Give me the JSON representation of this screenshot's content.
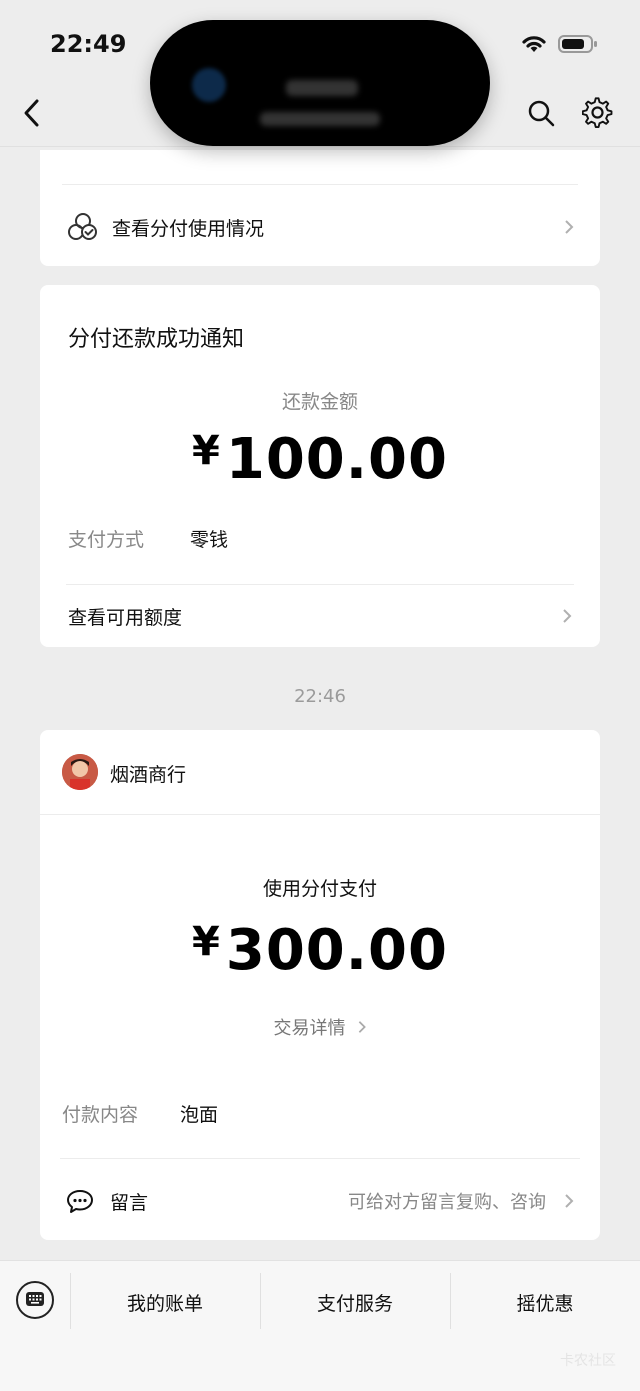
{
  "status_bar": {
    "time": "22:49"
  },
  "nav": {
    "back_icon": "chevron-left-icon",
    "search_icon": "search-icon",
    "settings_icon": "gear-icon"
  },
  "card1": {
    "link_label": "查看分付使用情况",
    "icon": "rings-check-icon"
  },
  "repay_notice": {
    "title": "分付还款成功通知",
    "amount_label": "还款金额",
    "currency": "¥",
    "amount": "100.00",
    "pay_method_key": "支付方式",
    "pay_method_value": "零钱",
    "link_label": "查看可用额度"
  },
  "timestamp": "22:46",
  "payment": {
    "merchant": "烟酒商行",
    "headline": "使用分付支付",
    "currency": "¥",
    "amount": "300.00",
    "detail_link": "交易详情",
    "content_key": "付款内容",
    "content_value": "泡面",
    "message_label": "留言",
    "message_hint": "可给对方留言复购、咨询"
  },
  "bottom_menu": {
    "keyboard_icon": "keyboard-icon",
    "items": [
      {
        "label": "我的账单"
      },
      {
        "label": "支付服务"
      },
      {
        "label": "摇优惠"
      }
    ]
  },
  "watermark": "卡农社区"
}
